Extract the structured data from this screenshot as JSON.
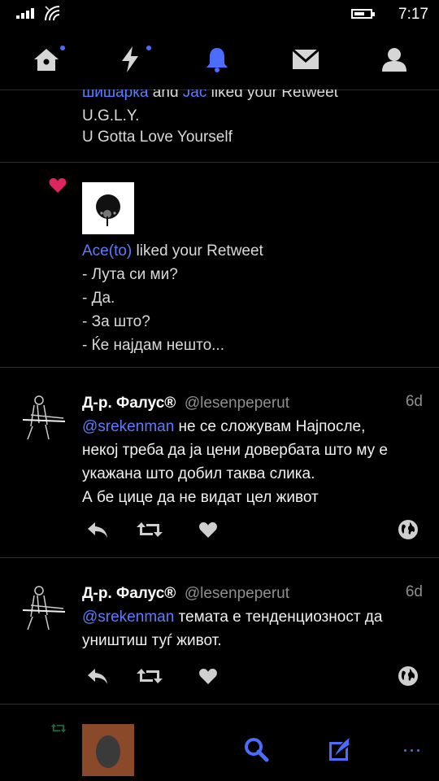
{
  "status": {
    "time": "7:17"
  },
  "nav": {
    "items": [
      {
        "name": "home"
      },
      {
        "name": "moments"
      },
      {
        "name": "notifications"
      },
      {
        "name": "messages"
      },
      {
        "name": "profile"
      }
    ]
  },
  "notifications": [
    {
      "actor1": "шишарка",
      "conj": " and ",
      "actor2": "Jac",
      "action": " liked your Retweet",
      "lines": [
        "U.G.L.Y.",
        "U Gotta Love Yourself"
      ]
    },
    {
      "actor1": "Ace(to)",
      "action": " liked your Retweet",
      "lines": [
        "- Лута си ми?",
        "- Да.",
        "- За што?",
        "- Ќе најдам нешто..."
      ]
    }
  ],
  "tweets": [
    {
      "name": "Д-р. Фалус®",
      "handle": "@lesenpeperut",
      "time": "6d",
      "mention": "@srekenman",
      "line1_rest": " не се сложувам Најпосле,",
      "lines": [
        "некој треба да ја цени довербата што му е",
        "укажана што добил таква слика.",
        "А бе цице да не видат цел живот"
      ]
    },
    {
      "name": "Д-р. Фалус®",
      "handle": "@lesenpeperut",
      "time": "6d",
      "mention": "@srekenman",
      "line1_rest": " темата е тенденциозност да",
      "lines": [
        "уништиш туѓ живот."
      ]
    }
  ],
  "colors": {
    "accent": "#4a6cff",
    "link": "#5d7bff",
    "like": "#e0245e"
  }
}
